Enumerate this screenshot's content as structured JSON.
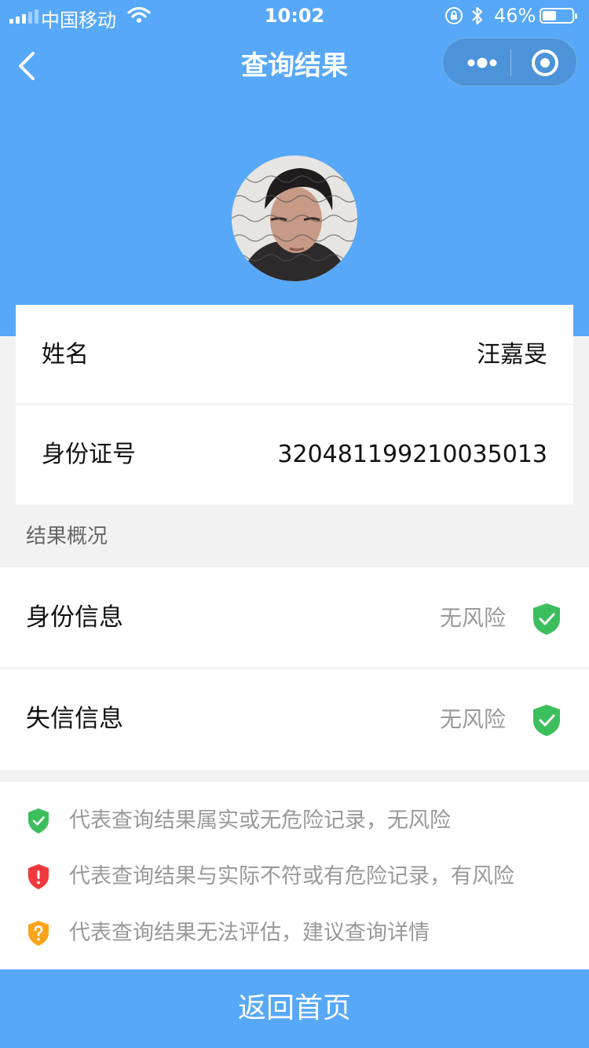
{
  "status_bar": {
    "carrier": "中国移动",
    "time": "10:02",
    "battery_percent": "46%",
    "battery_level": 0.46
  },
  "nav": {
    "title": "查询结果"
  },
  "profile": {
    "name_label": "姓名",
    "name_value": "汪嘉旻",
    "id_label": "身份证号",
    "id_value": "320481199210035013"
  },
  "summary": {
    "title": "结果概况",
    "items": [
      {
        "label": "身份信息",
        "status": "无风险",
        "icon": "shield-check-green-icon"
      },
      {
        "label": "失信信息",
        "status": "无风险",
        "icon": "shield-check-green-icon"
      }
    ]
  },
  "legend": [
    {
      "icon": "shield-check-green-icon",
      "color": "#3dbe5d",
      "text": "代表查询结果属实或无危险记录，无风险"
    },
    {
      "icon": "shield-exclamation-red-icon",
      "color": "#f0383d",
      "text": "代表查询结果与实际不符或有危险记录，有风险"
    },
    {
      "icon": "shield-question-orange-icon",
      "color": "#f9a41b",
      "text": "代表查询结果无法评估，建议查询详情"
    }
  ],
  "footer": {
    "button_label": "返回首页"
  },
  "colors": {
    "brand_blue": "#57a8f8",
    "safe_green": "#3dbe5d",
    "risk_red": "#f0383d",
    "unknown_orange": "#f9a41b"
  }
}
